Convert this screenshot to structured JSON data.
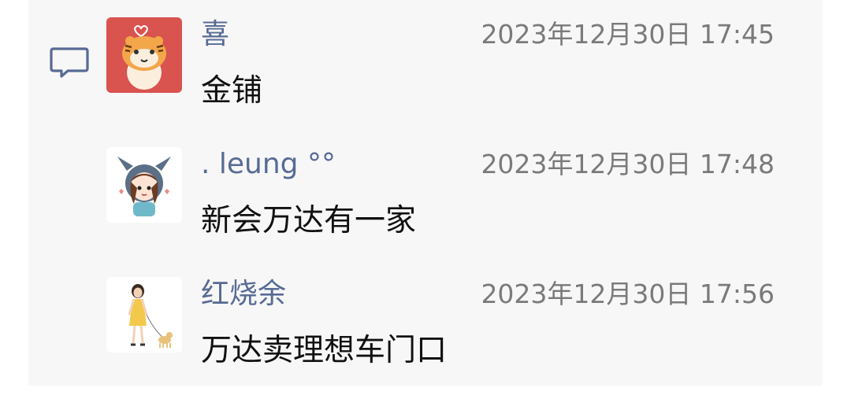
{
  "comments": [
    {
      "author": "喜",
      "time": "2023年12月30日 17:45",
      "text": "金铺",
      "avatar_icon": "tiger-cartoon-avatar"
    },
    {
      "author": ". leung °°",
      "time": "2023年12月30日 17:48",
      "text": "新会万达有一家",
      "avatar_icon": "girl-bunny-hood-avatar"
    },
    {
      "author": "红烧余",
      "time": "2023年12月30日 17:56",
      "text": "万达卖理想车门口",
      "avatar_icon": "girl-with-dog-avatar"
    }
  ],
  "colors": {
    "panel_background": "#f7f7f7",
    "author_name": "#576b95",
    "timestamp": "#7a7a7a",
    "comment_text": "#111111",
    "comment_icon": "#576b95"
  },
  "icons": {
    "comment_section_icon": "speech-bubble-icon"
  }
}
